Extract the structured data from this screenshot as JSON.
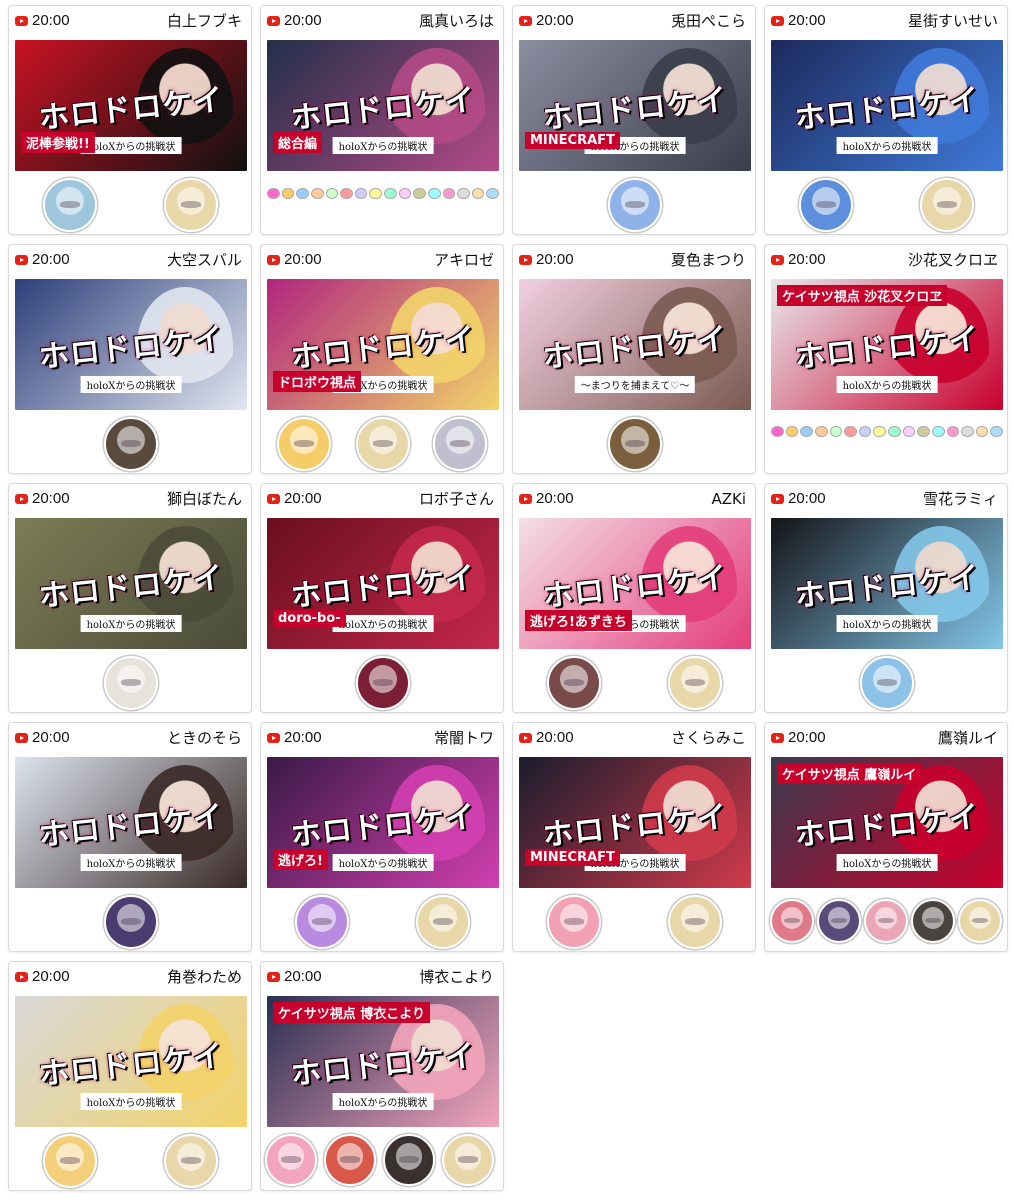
{
  "stream_time": "20:00",
  "icon": "youtube-play-icon",
  "cards": [
    {
      "name": "白上フブキ",
      "thumb_bg": "#c81222",
      "thumb_accent": "#111111",
      "logo": "ホロドロケイ",
      "sub": "holoXからの挑戦状",
      "badge": "泥棒参戦!!",
      "avatars": [
        "#9ec7de",
        "#e8d7a8"
      ]
    },
    {
      "name": "風真いろは",
      "thumb_bg": "#23304a",
      "thumb_accent": "#b34a86",
      "logo": "ホロドロケイ",
      "sub": "holoXからの挑戦状",
      "badge": "総合編",
      "strip": true,
      "avatars": []
    },
    {
      "name": "兎田ぺこら",
      "thumb_bg": "#8a8ea0",
      "thumb_accent": "#3a3d4a",
      "logo": "ホロドロケイ",
      "sub": "holoXからの挑戦状",
      "badge": "MINECRAFT",
      "avatars": [
        "#8fb3e8"
      ]
    },
    {
      "name": "星街すいせい",
      "thumb_bg": "#1c2a5c",
      "thumb_accent": "#3f7ad8",
      "logo": "ホロドロケイ",
      "sub": "holoXからの挑戦状",
      "badge": "",
      "avatars": [
        "#5e8fdc",
        "#e8d7a8"
      ]
    },
    {
      "name": "大空スバル",
      "thumb_bg": "#2d3f7a",
      "thumb_accent": "#e1e6f0",
      "logo": "ホロドロケイ",
      "sub": "holoXからの挑戦状",
      "badge": "",
      "avatars": [
        "#5a4a3e"
      ]
    },
    {
      "name": "アキロゼ",
      "thumb_bg": "#b0257e",
      "thumb_accent": "#f2d46a",
      "logo": "ホロドロケイ",
      "sub": "holoXからの挑戦状",
      "badge": "ドロボウ視点",
      "avatars": [
        "#f4cc68",
        "#e8d7a8",
        "#bfbfcf"
      ]
    },
    {
      "name": "夏色まつり",
      "thumb_bg": "#f1cfe0",
      "thumb_accent": "#7a5a50",
      "logo": "ホロドロケイ",
      "sub": "〜まつりを捕まえて♡〜",
      "badge": "",
      "avatars": [
        "#7b5e3d"
      ]
    },
    {
      "name": "沙花叉クロヱ",
      "thumb_bg": "#e8e8ec",
      "thumb_accent": "#c8002c",
      "logo": "ホロドロケイ",
      "sub": "holoXからの挑戦状",
      "badge": "ケイサツ視点 沙花叉クロヱ",
      "strip": true,
      "avatars": []
    },
    {
      "name": "獅白ぼたん",
      "thumb_bg": "#7b7d55",
      "thumb_accent": "#4a4c38",
      "logo": "ホロドロケイ",
      "sub": "holoXからの挑戦状",
      "badge": "",
      "avatars": [
        "#e6e2dc"
      ]
    },
    {
      "name": "ロボ子さん",
      "thumb_bg": "#6a0f1e",
      "thumb_accent": "#c3284a",
      "logo": "ホロドロケイ",
      "sub": "holoXからの挑戦状",
      "badge": "doro-bo-",
      "avatars": [
        "#7a1f35"
      ]
    },
    {
      "name": "AZKi",
      "thumb_bg": "#f4dfe6",
      "thumb_accent": "#e33d7a",
      "logo": "ホロドロケイ",
      "sub": "holoXからの挑戦状",
      "badge": "逃げろ!あずきち",
      "avatars": [
        "#7a4a4a",
        "#e8d7a8"
      ]
    },
    {
      "name": "雪花ラミィ",
      "thumb_bg": "#141418",
      "thumb_accent": "#83c6e8",
      "logo": "ホロドロケイ",
      "sub": "holoXからの挑戦状",
      "badge": "",
      "avatars": [
        "#8cc1e8"
      ]
    },
    {
      "name": "ときのそら",
      "thumb_bg": "#dce4ee",
      "thumb_accent": "#3a2a28",
      "logo": "ホロドロケイ",
      "sub": "holoXからの挑戦状",
      "badge": "",
      "avatars": [
        "#4b3c70"
      ]
    },
    {
      "name": "常闇トワ",
      "thumb_bg": "#3a1a46",
      "thumb_accent": "#d23fb0",
      "logo": "ホロドロケイ",
      "sub": "holoXからの挑戦状",
      "badge": "逃げろ!",
      "avatars": [
        "#b88be0",
        "#e8d7a8"
      ]
    },
    {
      "name": "さくらみこ",
      "thumb_bg": "#1a1d2e",
      "thumb_accent": "#d03a4a",
      "logo": "ホロドロケイ",
      "sub": "holoXからの挑戦状",
      "badge": "MINECRAFT",
      "avatars": [
        "#f2a0b4",
        "#e8d7a8"
      ]
    },
    {
      "name": "鷹嶺ルイ",
      "thumb_bg": "#3a3a4e",
      "thumb_accent": "#c8002c",
      "logo": "ホロドロケイ",
      "sub": "holoXからの挑戦状",
      "badge": "ケイサツ視点 鷹嶺ルイ",
      "avatars_small": [
        "#e07a88",
        "#5a4a7a",
        "#eaa5b8",
        "#4a4440",
        "#e8d7a8"
      ]
    },
    {
      "name": "角巻わため",
      "thumb_bg": "#d8d8d8",
      "thumb_accent": "#f2d36a",
      "logo": "ホロドロケイ",
      "sub": "holoXからの挑戦状",
      "badge": "",
      "avatars": [
        "#f4cf7a",
        "#e8d7a8"
      ]
    },
    {
      "name": "博衣こより",
      "thumb_bg": "#2a2e52",
      "thumb_accent": "#f2a5bc",
      "logo": "ホロドロケイ",
      "sub": "holoXからの挑戦状",
      "badge": "ケイサツ視点 博衣こより",
      "avatars": [
        "#f2a5bc",
        "#d8584a",
        "#3a3030",
        "#e8d7a8"
      ]
    }
  ]
}
